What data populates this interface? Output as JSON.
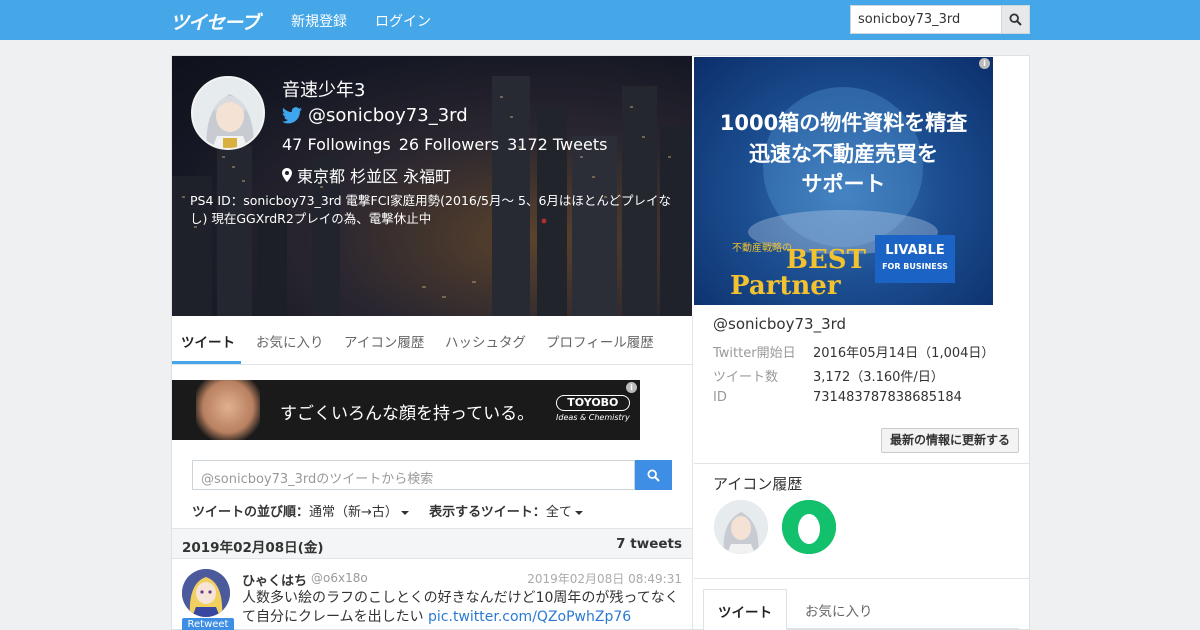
{
  "header": {
    "logo": "ツイセーブ",
    "nav": [
      "新規登録",
      "ログイン"
    ],
    "search_value": "sonicboy73_3rd"
  },
  "profile": {
    "name": "音速少年3",
    "handle": "@sonicboy73_3rd",
    "followings": "47 Followings",
    "followers": "26 Followers",
    "tweets": "3172 Tweets",
    "location": "東京都 杉並区 永福町",
    "bio": "PS4 ID：sonicboy73_3rd 電撃FCI家庭用勢(2016/5月～ 5、6月はほとんどプレイなし) 現在GGXrdR2プレイの為、電撃休止中"
  },
  "tabs": [
    "ツイート",
    "お気に入り",
    "アイコン履歴",
    "ハッシュタグ",
    "プロフィール履歴"
  ],
  "ad_left": {
    "text": "すごくいろんな顔を持っている。",
    "brand": "TOYOBO",
    "brand_sub": "Ideas & Chemistry"
  },
  "tweet_search": {
    "placeholder": "@sonicboy73_3rdのツイートから検索"
  },
  "sort": {
    "order_label": "ツイートの並び順：",
    "order_value": "通常（新→古）",
    "show_label": "表示するツイート：",
    "show_value": "全て"
  },
  "day": {
    "date": "2019年02月08日(金)",
    "count": "7 tweets"
  },
  "tweet": {
    "name": "ひゃくはち",
    "id": "@o6x18o",
    "time": "2019年02月08日 08:49:31",
    "text": "人数多い絵のラフのこしとくの好きなんだけど10周年のが残ってなくて自分にクレームを出したい ",
    "link": "pic.twitter.com/QZoPwhZp76",
    "badge": "Retweet"
  },
  "ad_right": {
    "line1": "1000箱の物件資料を精査",
    "line2": "迅速な不動産売買を",
    "line3": "サポート",
    "small": "不動産戦略の",
    "best": "BEST",
    "partner": "Partner",
    "logo": "LIVABLE",
    "logo_sub": "FOR BUSINESS"
  },
  "account": {
    "handle": "@sonicboy73_3rd",
    "rows": [
      {
        "label": "Twitter開始日",
        "value": "2016年05月14日（1,004日）"
      },
      {
        "label": "ツイート数",
        "value": "3,172（3.160件/日）"
      },
      {
        "label": "ID",
        "value": "731483787838685184"
      }
    ],
    "update_button": "最新の情報に更新する"
  },
  "icon_history": {
    "title": "アイコン履歴"
  },
  "right_tabs": [
    "ツイート",
    "お気に入り"
  ],
  "colors": {
    "header": "#45a7e8",
    "primary_button": "#3e8ee6",
    "link": "#2a7ad2",
    "history_icon_green": "#13c06b"
  }
}
